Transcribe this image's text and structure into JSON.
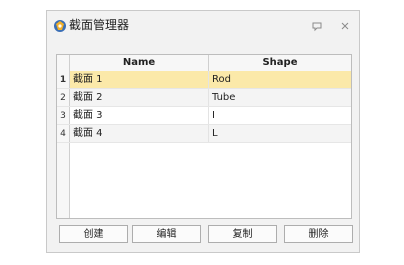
{
  "window": {
    "title": "截面管理器",
    "app_icon": "app-logo-icon",
    "minimize_icon": "restore-icon",
    "close_icon": "close-icon"
  },
  "table": {
    "columns": [
      "Name",
      "Shape"
    ],
    "rows": [
      {
        "index": "1",
        "name": "截面 1",
        "shape": "Rod",
        "selected": true
      },
      {
        "index": "2",
        "name": "截面 2",
        "shape": "Tube",
        "selected": false
      },
      {
        "index": "3",
        "name": "截面 3",
        "shape": "I",
        "selected": false
      },
      {
        "index": "4",
        "name": "截面 4",
        "shape": "L",
        "selected": false
      }
    ],
    "selected_row_color": "#fbe9a9"
  },
  "buttons": {
    "create": "创建",
    "edit": "编辑",
    "copy": "复制",
    "delete": "删除"
  }
}
